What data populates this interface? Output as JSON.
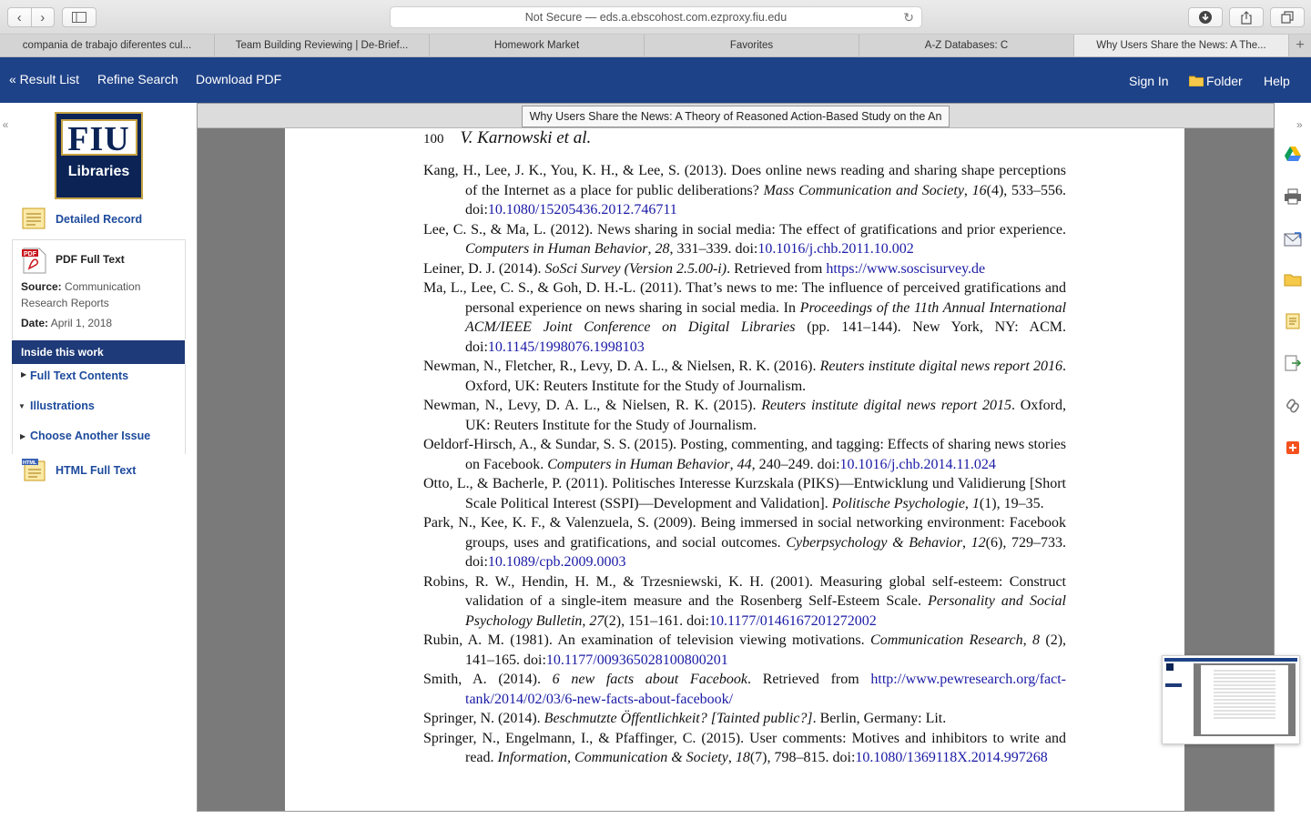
{
  "browser": {
    "address": "Not Secure — eds.a.ebscohost.com.ezproxy.fiu.edu",
    "back_glyph": "‹",
    "forward_glyph": "›",
    "reload_glyph": "↻",
    "tabs": [
      "compania de trabajo diferentes cul...",
      "Team Building Reviewing | De-Brief...",
      "Homework Market",
      "Favorites",
      "A-Z Databases: C",
      "Why Users Share the News: A The..."
    ],
    "new_tab_glyph": "+"
  },
  "ebsco": {
    "result_list": "« Result List",
    "refine_search": "Refine Search",
    "download_pdf": "Download PDF",
    "sign_in": "Sign In",
    "folder": "Folder",
    "help": "Help"
  },
  "sidebar": {
    "collapse_glyph": "«",
    "logo_top": "FIU",
    "logo_bottom": "Libraries",
    "detailed_record": "Detailed Record",
    "pdf_full_text": "PDF Full Text",
    "source_label": "Source:",
    "source_value": "Communication Research Reports",
    "date_label": "Date:",
    "date_value": "April 1, 2018",
    "inside_this_work": "Inside this work",
    "full_text_contents": "Full Text Contents",
    "illustrations": "Illustrations",
    "choose_another_issue": "Choose Another Issue",
    "html_full_text": "HTML Full Text"
  },
  "viewer": {
    "doc_title": "Why Users Share the News: A Theory of Reasoned Action-Based Study on the An",
    "page_number": "100",
    "page_author": "V. Karnowski et al.",
    "right_collapse_glyph": "»"
  },
  "accent": {
    "ebsco_blue": "#1e4288",
    "link_blue": "#1d4a9c",
    "fiu_navy": "#0b2355",
    "fiu_gold": "#c5a344"
  }
}
